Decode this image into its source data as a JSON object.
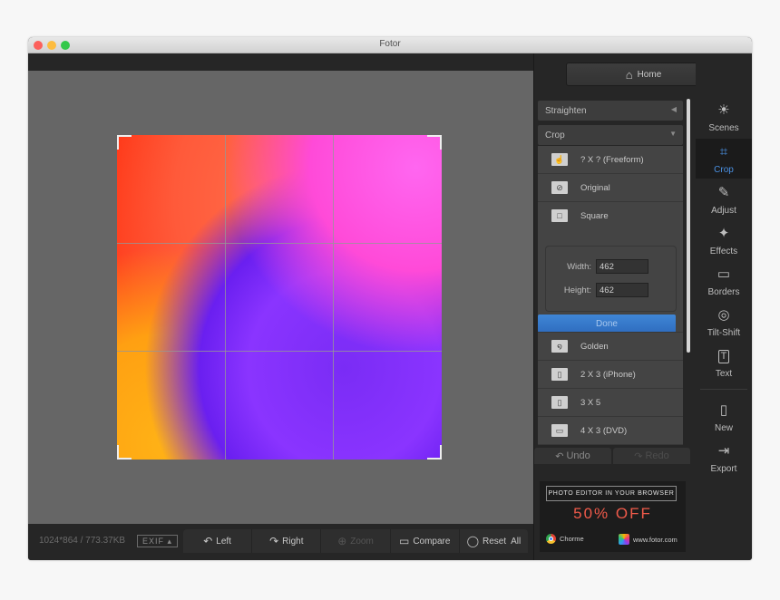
{
  "window": {
    "title": "Fotor"
  },
  "canvas": {
    "image_info": "1024*864 / 773.37KB",
    "exif_label": "EXIF",
    "toolbar": [
      {
        "label": "Left",
        "icon": "rotate-left-icon",
        "glyph": "↶",
        "enabled": true
      },
      {
        "label": "Right",
        "icon": "rotate-right-icon",
        "glyph": "↷",
        "enabled": true
      },
      {
        "label": "Zoom",
        "icon": "zoom-icon",
        "glyph": "⊕",
        "enabled": false
      },
      {
        "label": "Compare",
        "icon": "compare-icon",
        "glyph": "▭",
        "enabled": true
      },
      {
        "label": "Reset  All",
        "icon": "reset-icon",
        "glyph": "◯",
        "enabled": true
      }
    ]
  },
  "panel": {
    "home_label": "Home",
    "straighten_label": "Straighten",
    "crop_label": "Crop",
    "crop_options_top": [
      {
        "label": "? X ? (Freeform)",
        "icon": "freeform-hand-icon",
        "glyph": "☝"
      },
      {
        "label": "Original",
        "icon": "original-icon",
        "glyph": "⊘"
      },
      {
        "label": "Square",
        "icon": "square-icon",
        "glyph": "□"
      }
    ],
    "width_label": "Width:",
    "width_value": "462",
    "height_label": "Height:",
    "height_value": "462",
    "done_label": "Done",
    "crop_options_bottom": [
      {
        "label": "Golden",
        "icon": "golden-spiral-icon",
        "glyph": "໑"
      },
      {
        "label": "2 X 3 (iPhone)",
        "icon": "portrait-ratio-icon",
        "glyph": "▯"
      },
      {
        "label": "3 X 5",
        "icon": "portrait-ratio-icon",
        "glyph": "▯"
      },
      {
        "label": "4 X 3 (DVD)",
        "icon": "landscape-ratio-icon",
        "glyph": "▭"
      }
    ],
    "undo_label": "Undo",
    "redo_label": "Redo",
    "ad": {
      "headline": "PHOTO EDITOR IN YOUR BROWSER",
      "offer": "50% OFF",
      "left_label": "Chorme",
      "right_label": "www.fotor.com"
    }
  },
  "sidebar": {
    "items": [
      {
        "label": "Scenes",
        "icon": "scenes-sun-icon",
        "glyph": "☀",
        "active": false
      },
      {
        "label": "Crop",
        "icon": "crop-icon",
        "glyph": "⌗",
        "active": true
      },
      {
        "label": "Adjust",
        "icon": "pencil-icon",
        "glyph": "✎",
        "active": false
      },
      {
        "label": "Effects",
        "icon": "sparkle-icon",
        "glyph": "✦",
        "active": false
      },
      {
        "label": "Borders",
        "icon": "border-frame-icon",
        "glyph": "▭",
        "active": false
      },
      {
        "label": "Tilt-Shift",
        "icon": "tilt-shift-icon",
        "glyph": "◎",
        "active": false
      },
      {
        "label": "Text",
        "icon": "text-icon",
        "glyph": "T",
        "active": false
      }
    ],
    "bottom_items": [
      {
        "label": "New",
        "icon": "new-file-icon",
        "glyph": "🗋"
      },
      {
        "label": "Export",
        "icon": "export-icon",
        "glyph": "⇥"
      }
    ]
  },
  "colors": {
    "accent": "#4a90e2",
    "done_button": "#3577c9",
    "offer": "#f05a4a"
  }
}
